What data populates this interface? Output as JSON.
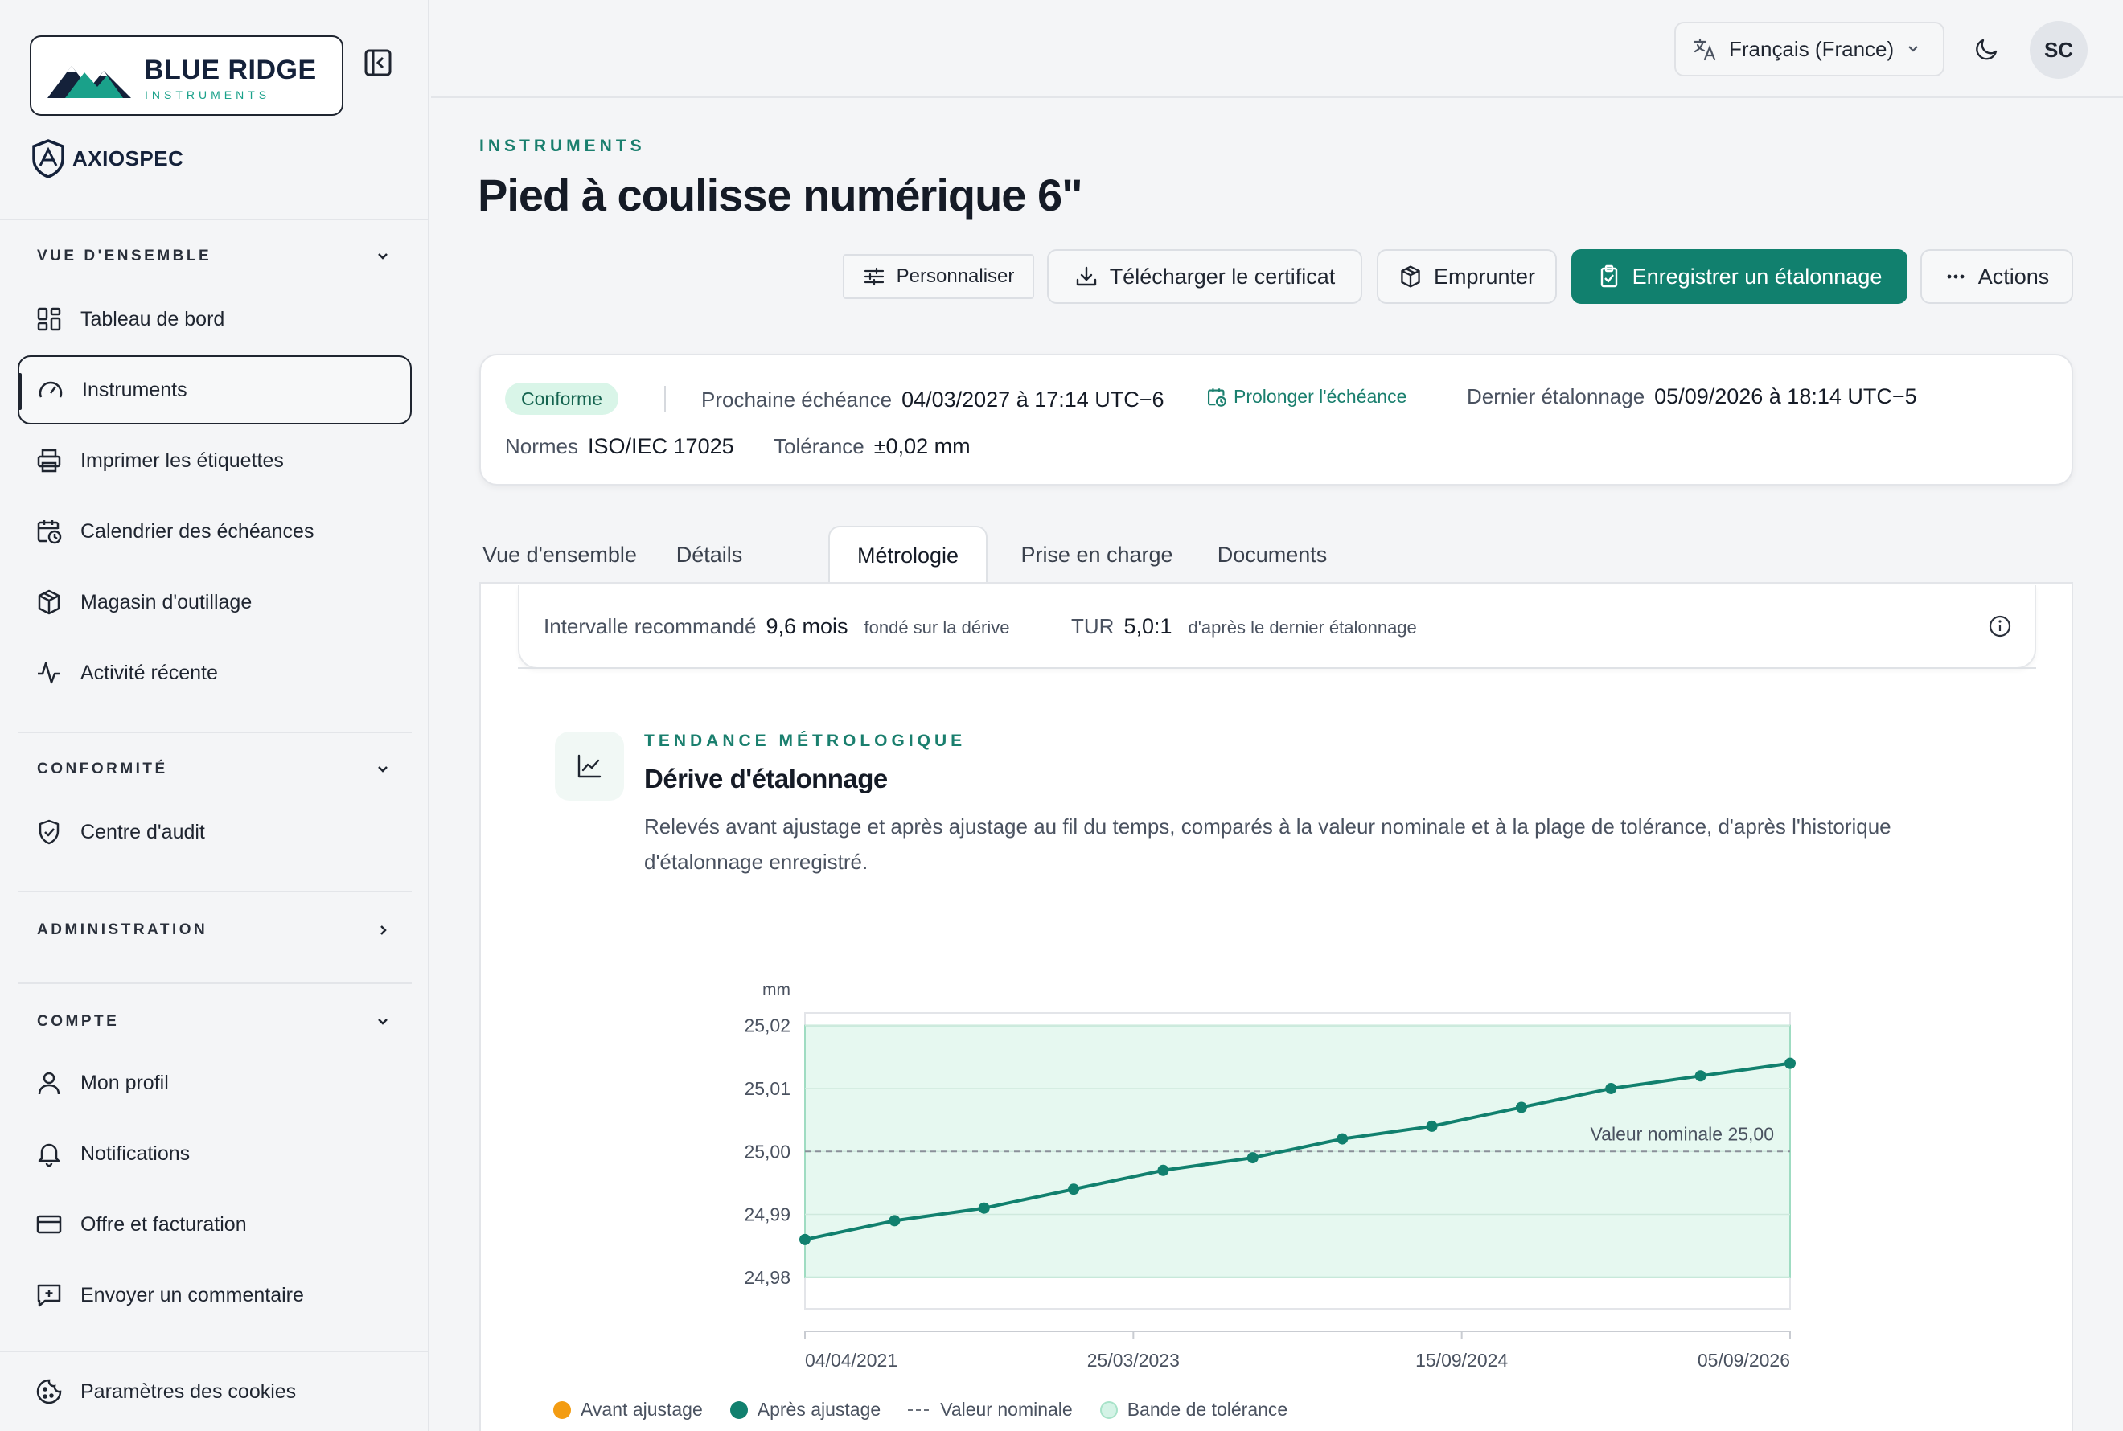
{
  "brand": {
    "name": "BLUE RIDGE",
    "subtitle": "INSTRUMENTS",
    "product": "AXIOSPEC"
  },
  "sidebar": {
    "sections": [
      {
        "title": "VUE D'ENSEMBLE",
        "items": [
          {
            "label": "Tableau de bord",
            "icon": "dashboard-icon"
          },
          {
            "label": "Instruments",
            "icon": "gauge-icon",
            "active": true
          },
          {
            "label": "Imprimer les étiquettes",
            "icon": "printer-icon"
          },
          {
            "label": "Calendrier des échéances",
            "icon": "calendar-clock-icon"
          },
          {
            "label": "Magasin d'outillage",
            "icon": "package-icon"
          },
          {
            "label": "Activité récente",
            "icon": "activity-icon"
          }
        ]
      },
      {
        "title": "CONFORMITÉ",
        "items": [
          {
            "label": "Centre d'audit",
            "icon": "shield-check-icon"
          }
        ]
      },
      {
        "title": "ADMINISTRATION",
        "items": []
      },
      {
        "title": "COMPTE",
        "items": [
          {
            "label": "Mon profil",
            "icon": "user-icon"
          },
          {
            "label": "Notifications",
            "icon": "bell-icon"
          },
          {
            "label": "Offre et facturation",
            "icon": "credit-card-icon"
          },
          {
            "label": "Envoyer un commentaire",
            "icon": "message-plus-icon"
          }
        ]
      }
    ],
    "footer_item": {
      "label": "Paramètres des cookies",
      "icon": "cookie-icon"
    }
  },
  "topbar": {
    "language": "Français (France)",
    "avatar_initials": "SC"
  },
  "header": {
    "eyebrow": "INSTRUMENTS",
    "title": "Pied à coulisse numérique 6\"",
    "buttons": {
      "customize": "Personnaliser",
      "download": "Télécharger le certificat",
      "borrow": "Emprunter",
      "record": "Enregistrer un étalonnage",
      "actions": "Actions"
    }
  },
  "summary": {
    "status": "Conforme",
    "next_due_label": "Prochaine échéance",
    "next_due_value": "04/03/2027 à 17:14 UTC−6",
    "extend_link": "Prolonger l'échéance",
    "last_cal_label": "Dernier étalonnage",
    "last_cal_value": "05/09/2026 à 18:14 UTC−5",
    "standards_label": "Normes",
    "standards_value": "ISO/IEC 17025",
    "tolerance_label": "Tolérance",
    "tolerance_value": "±0,02 mm"
  },
  "tabs": [
    "Vue d'ensemble",
    "Détails",
    "Métrologie",
    "Prise en charge",
    "Documents"
  ],
  "active_tab": 2,
  "interval": {
    "label": "Intervalle recommandé",
    "value": "9,6 mois",
    "note": "fondé sur la dérive",
    "tur_label": "TUR",
    "tur_value": "5,0:1",
    "tur_note": "d'après le dernier étalonnage"
  },
  "trend": {
    "eyebrow": "TENDANCE MÉTROLOGIQUE",
    "title": "Dérive d'étalonnage",
    "description": "Relevés avant ajustage et après ajustage au fil du temps, comparés à la valeur nominale et à la plage de tolérance, d'après l'historique d'étalonnage enregistré."
  },
  "chart_data": {
    "type": "line",
    "unit_label": "mm",
    "ylim": [
      24.975,
      25.022
    ],
    "yticks": [
      25.02,
      25.01,
      25.0,
      24.99,
      24.98
    ],
    "ytick_labels": [
      "25,02",
      "25,01",
      "25,00",
      "24,99",
      "24,98"
    ],
    "xticks": [
      "04/04/2021",
      "25/03/2023",
      "15/09/2024",
      "05/09/2026"
    ],
    "xlim_index": [
      0,
      11
    ],
    "tolerance_band": [
      24.98,
      25.02
    ],
    "nominal": 25.0,
    "nominal_label": "Valeur nominale 25,00",
    "series": [
      {
        "name": "Après ajustage",
        "color": "#11806e",
        "values": [
          24.986,
          24.989,
          24.991,
          24.994,
          24.997,
          24.999,
          25.002,
          25.004,
          25.007,
          25.01,
          25.012,
          25.014
        ]
      }
    ],
    "legend": [
      {
        "label": "Avant ajustage",
        "color": "#f39c12"
      },
      {
        "label": "Après ajustage",
        "color": "#11806e"
      },
      {
        "label": "Valeur nominale",
        "style": "dashed"
      },
      {
        "label": "Bande de tolérance",
        "color": "#d4f3e6"
      }
    ]
  }
}
